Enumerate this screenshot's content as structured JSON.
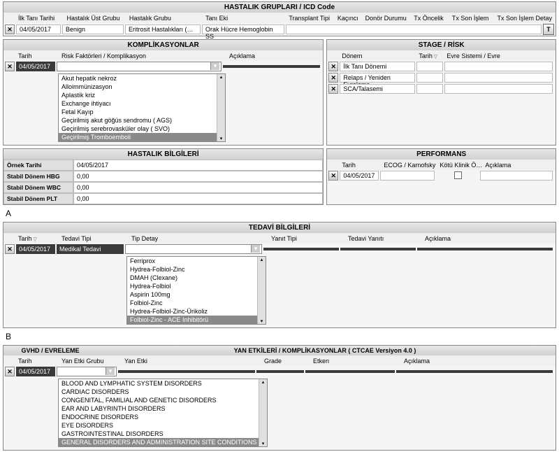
{
  "icd": {
    "title": "HASTALIK GRUPLARI  /  ICD Code",
    "headers": [
      "İlk Tanı Tarihi",
      "Hastalık Üst Grubu",
      "Hastalık Grubu",
      "Tanı Eki",
      "Transplant Tipi",
      "Kaçıncı",
      "Donör Durumu",
      "Tx Öncelik",
      "Tx Son İşlem",
      "Tx Son İşlem Detay"
    ],
    "row": {
      "date": "04/05/2017",
      "ust": "Benign",
      "grup": "Eritrosit Hastalıkları (…",
      "tani": "Orak Hücre Hemoglobin SS"
    }
  },
  "komp": {
    "title": "KOMPLİKASYONLAR",
    "headers": [
      "Tarih",
      "Risk Faktörleri / Komplikasyon",
      "Açıklama"
    ],
    "row": {
      "date": "04/05/2017"
    },
    "list": [
      "Akut hepatik nekroz",
      "Alloimmünizasyon",
      "Aplastik kriz",
      "Exchange ihtiyacı",
      "Fetal Kayıp",
      "Geçirilmiş akut göğüs sendromu ( AGS)",
      "Geçirilmiş serebrovasküler olay ( SVO)",
      "Geçirilmiş Tromboemboli"
    ],
    "selected_index": 7
  },
  "stage": {
    "title": "STAGE /  RİSK",
    "headers": [
      "",
      "Dönem",
      "Tarih",
      "Evre Sistemi / Evre"
    ],
    "rows": [
      {
        "donem": "İlk Tanı Dönemi"
      },
      {
        "donem": "Relaps / Yeniden Evreleme"
      },
      {
        "donem": "SCA/Talasemi"
      }
    ]
  },
  "hasta": {
    "title": "HASTALIK BİLGİLERİ",
    "rows": [
      {
        "lab": "Örnek Tarihi",
        "val": "04/05/2017"
      },
      {
        "lab": "Stabil Dönem HBG",
        "val": "0,00"
      },
      {
        "lab": "Stabil Dönem WBC",
        "val": "0,00"
      },
      {
        "lab": "Stabil Dönem PLT",
        "val": "0,00"
      }
    ]
  },
  "perf": {
    "title": "PERFORMANS",
    "headers": [
      "Tarih",
      "ECOG / Karnofsky",
      "Kötü Klinik Ö…",
      "Açıklama"
    ],
    "row": {
      "date": "04/05/2017"
    }
  },
  "letterA": "A",
  "tedavi": {
    "title": "TEDAVİ BİLGİLERİ",
    "headers": [
      "Tarih",
      "Tedavi Tipi",
      "Tip Detay",
      "Yanıt Tipi",
      "Tedavi Yanıtı",
      "Açıklama"
    ],
    "row": {
      "date": "04/05/2017",
      "tip": "Medikal Tedavi"
    },
    "list": [
      "Ferriprox",
      "Hydrea-Folbiol-Zinc",
      "DMAH (Clexane)",
      "Hydrea-Folbiol",
      "Aspirin 100mg",
      "Folbiol-Zinc",
      "Hydrea-Folbiol-Zinc-Ürikoliz",
      "Folbiol-Zinc - ACE Inhibitörü"
    ],
    "selected_index": 7
  },
  "letterB": "B",
  "gvhd": {
    "title_a": "GVHD /  EVRELEME",
    "title_b": "YAN ETKİLERİ  /  KOMPLİKASYONLAR  ( CTCAE Versiyon 4.0 )",
    "headers": [
      "Tarih",
      "Yan Etki Grubu",
      "Yan Etki",
      "Grade",
      "Etken",
      "Açıklama"
    ],
    "row": {
      "date": "04/05/2017"
    },
    "list": [
      "BLOOD AND LYMPHATIC SYSTEM DISORDERS",
      "CARDIAC DISORDERS",
      "CONGENITAL, FAMILIAL AND GENETIC DISORDERS",
      "EAR AND LABYRINTH DISORDERS",
      "ENDOCRINE DISORDERS",
      "EYE DISORDERS",
      "GASTROINTESTINAL DISORDERS",
      "GENERAL DISORDERS AND ADMINISTRATION SITE CONDITIONS"
    ],
    "selected_index": 7
  }
}
